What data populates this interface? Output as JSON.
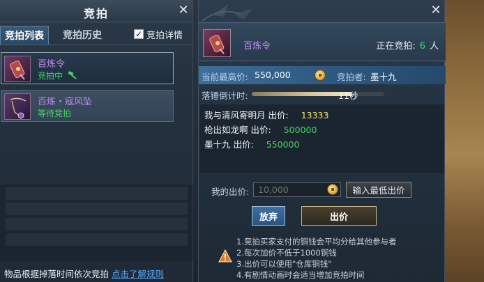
{
  "left_panel": {
    "title": "竞拍",
    "tabs": [
      "竞拍列表",
      "竞拍历史"
    ],
    "detail_checkbox": {
      "checked": true,
      "label": "竞拍详情"
    },
    "items": [
      {
        "name": "百炼令",
        "status": "竞拍中",
        "name_color": "#c28cf0",
        "status_color": "#46d266"
      },
      {
        "name": "百炼・寇风坠",
        "status": "等待竞拍",
        "name_color": "#c28cf0",
        "status_color": "#46d266"
      }
    ],
    "bottom_note": "物品根据掉落时间依次竞拍",
    "rules_link": "点击了解规则"
  },
  "right_panel": {
    "item_name": "百炼令",
    "bidding_label_prefix": "正在竞拍:",
    "bidding_count": "6",
    "bidding_unit": "人",
    "highest_price_label": "当前最高价:",
    "highest_price": "550,000",
    "bidder_label": "竞拍者:",
    "bidder": "墨十九",
    "countdown_label": "落锤倒计时:",
    "countdown_value": "11秒",
    "countdown_fraction": 0.75,
    "bid_log": [
      {
        "bidder": "我与清风寄明月",
        "label": "出价:",
        "price": "13333",
        "price_color": "#f0e060"
      },
      {
        "bidder": "枪出如龙啊",
        "label": "出价:",
        "price": "500000",
        "price_color": "#46d266"
      },
      {
        "bidder": "墨十九",
        "label": "出价:",
        "price": "550000",
        "price_color": "#46d266"
      }
    ],
    "my_bid_label": "我的出价:",
    "my_bid_placeholder": "10,000",
    "min_bid_button": "输入最低出价",
    "give_up_button": "放弃",
    "bid_button": "出价",
    "rules": [
      "1.竞拍买家支付的铜钱会平均分给其他参与者",
      "2.每次加价不低于1000铜钱",
      "3.出价可以使用\"仓库铜钱\"",
      "4.有剧情动画时会适当增加竞拍时间"
    ]
  }
}
